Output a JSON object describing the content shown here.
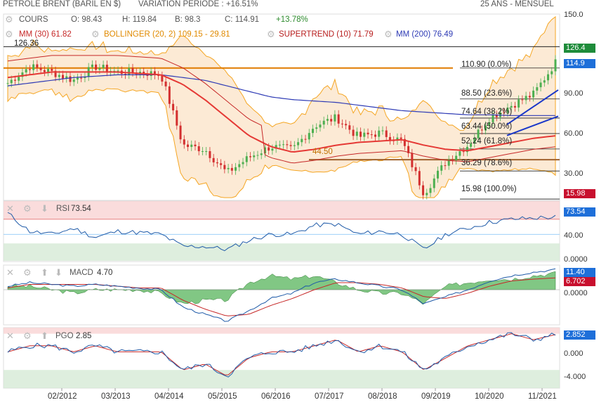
{
  "header": {
    "title": "PETROLE BRENT (BARIL EN $)",
    "variation": "VARIATION PERIODE : +16.51%",
    "period": "25 ANS - MENSUEL"
  },
  "legend_row1": {
    "cours": "COURS",
    "o": "O: 98.43",
    "h": "H: 119.84",
    "b": "B: 98.3",
    "c": "C: 114.91",
    "pct": "+13.78%"
  },
  "legend_row2": {
    "mm30": "MM (30) 61.82",
    "bollinger": "BOLLINGER (20, 2) 109.15 - 29.81",
    "supertrend": "SUPERTREND (10) 71.79",
    "mm200": "MM (200) 76.49"
  },
  "colors": {
    "up": "#4caf50",
    "down": "#d32f2f",
    "mm30": "#e53935",
    "bollinger": "#f5a623",
    "supertrend": "#c62828",
    "mm200": "#2e3bb5",
    "fib": "#e07b00",
    "blue_tag": "#1e6fd9",
    "green_tag": "#1e8c3a",
    "red_tag": "#c8102e"
  },
  "price_axis": {
    "ticks": [
      "150.0",
      "90.00",
      "60.00",
      "30.00"
    ],
    "tags": {
      "high": "126.4",
      "last": "114.9",
      "low": "15.98"
    },
    "annot_high": "126.36"
  },
  "fib_levels": [
    {
      "label": "110.90  (0.0%)",
      "value": 110.9
    },
    {
      "label": "88.50  (23.6%)",
      "value": 88.5
    },
    {
      "label": "74.64  (38.2%)",
      "value": 74.64
    },
    {
      "label": "63.44  (50.0%)",
      "value": 63.44
    },
    {
      "label": "52.24  (61.8%)",
      "value": 52.24
    },
    {
      "label": "36.29  (78.6%)",
      "value": 36.29
    },
    {
      "label": "15.98  (100.0%)",
      "value": 15.98
    }
  ],
  "support_label": "44.50",
  "rsi": {
    "label": "RSI",
    "value": "73.54",
    "ticks": [
      "40.00",
      "0.0000"
    ]
  },
  "macd": {
    "label": "MACD",
    "value": "4.70",
    "tag1": "11.40",
    "tag2": "6.702",
    "ticks": [
      "0.0000"
    ]
  },
  "pgo": {
    "label": "PGO",
    "value": "2.85",
    "tag": "2.852",
    "ticks": [
      "0.000",
      "-4.000"
    ]
  },
  "x_labels": [
    "02/2012",
    "03/2013",
    "04/2014",
    "05/2015",
    "06/2016",
    "07/2017",
    "08/2018",
    "09/2019",
    "10/2020",
    "11/2021"
  ],
  "chart_data": {
    "type": "line",
    "title": "PETROLE BRENT (BARIL EN $)",
    "x": [
      "2011-01",
      "2011-07",
      "2012-01",
      "2012-07",
      "2013-01",
      "2013-07",
      "2014-01",
      "2014-07",
      "2015-01",
      "2015-07",
      "2016-01",
      "2016-07",
      "2017-01",
      "2017-07",
      "2018-01",
      "2018-07",
      "2019-01",
      "2019-07",
      "2020-01",
      "2020-04",
      "2020-07",
      "2021-01",
      "2021-07",
      "2021-10",
      "2022-01",
      "2022-03"
    ],
    "series": [
      {
        "name": "COURS",
        "values": [
          100,
          112,
          108,
          102,
          112,
          108,
          108,
          106,
          55,
          52,
          35,
          46,
          54,
          52,
          69,
          75,
          61,
          64,
          58,
          20,
          43,
          55,
          75,
          84,
          92,
          114.9
        ]
      },
      {
        "name": "MM (30)",
        "values": [
          104,
          106,
          108,
          108,
          108,
          108,
          107,
          106,
          99,
          88,
          75,
          62,
          54,
          50,
          52,
          55,
          57,
          58,
          59,
          55,
          52,
          51,
          54,
          57,
          60,
          61.82
        ]
      },
      {
        "name": "MM (200)",
        "values": [
          98,
          100,
          102,
          104,
          105,
          106,
          106,
          106,
          104,
          102,
          98,
          94,
          90,
          88,
          87,
          86,
          84,
          82,
          80,
          79,
          78,
          77,
          77,
          76.5,
          76.5,
          76.49
        ]
      }
    ],
    "ylim": [
      15,
      150
    ],
    "rsi": {
      "values": [
        80,
        50,
        45,
        55,
        40,
        50,
        48,
        45,
        25,
        25,
        20,
        35,
        45,
        45,
        60,
        62,
        45,
        50,
        45,
        20,
        45,
        55,
        65,
        70,
        72,
        73.54
      ],
      "ylim": [
        0,
        100
      ]
    },
    "macd": {
      "values": [
        2,
        4,
        3,
        2,
        3,
        2,
        1,
        0,
        -10,
        -14,
        -18,
        -12,
        -5,
        -2,
        4,
        6,
        4,
        2,
        0,
        -8,
        -4,
        0,
        5,
        8,
        10,
        11.4
      ],
      "signal": [
        1,
        3,
        3,
        3,
        3,
        2,
        1,
        1,
        -6,
        -11,
        -15,
        -14,
        -9,
        -5,
        0,
        4,
        4,
        3,
        1,
        -4,
        -5,
        -2,
        2,
        5,
        6,
        6.702
      ],
      "ylim": [
        -20,
        14
      ]
    },
    "pgo": {
      "values": [
        0,
        1,
        1,
        0,
        1,
        0,
        0,
        0,
        -3,
        -2,
        -4,
        -1,
        0,
        0,
        1,
        2,
        0,
        1,
        0,
        -3,
        -1,
        1,
        2,
        3,
        2,
        2.852
      ],
      "ylim": [
        -6,
        4
      ]
    }
  }
}
